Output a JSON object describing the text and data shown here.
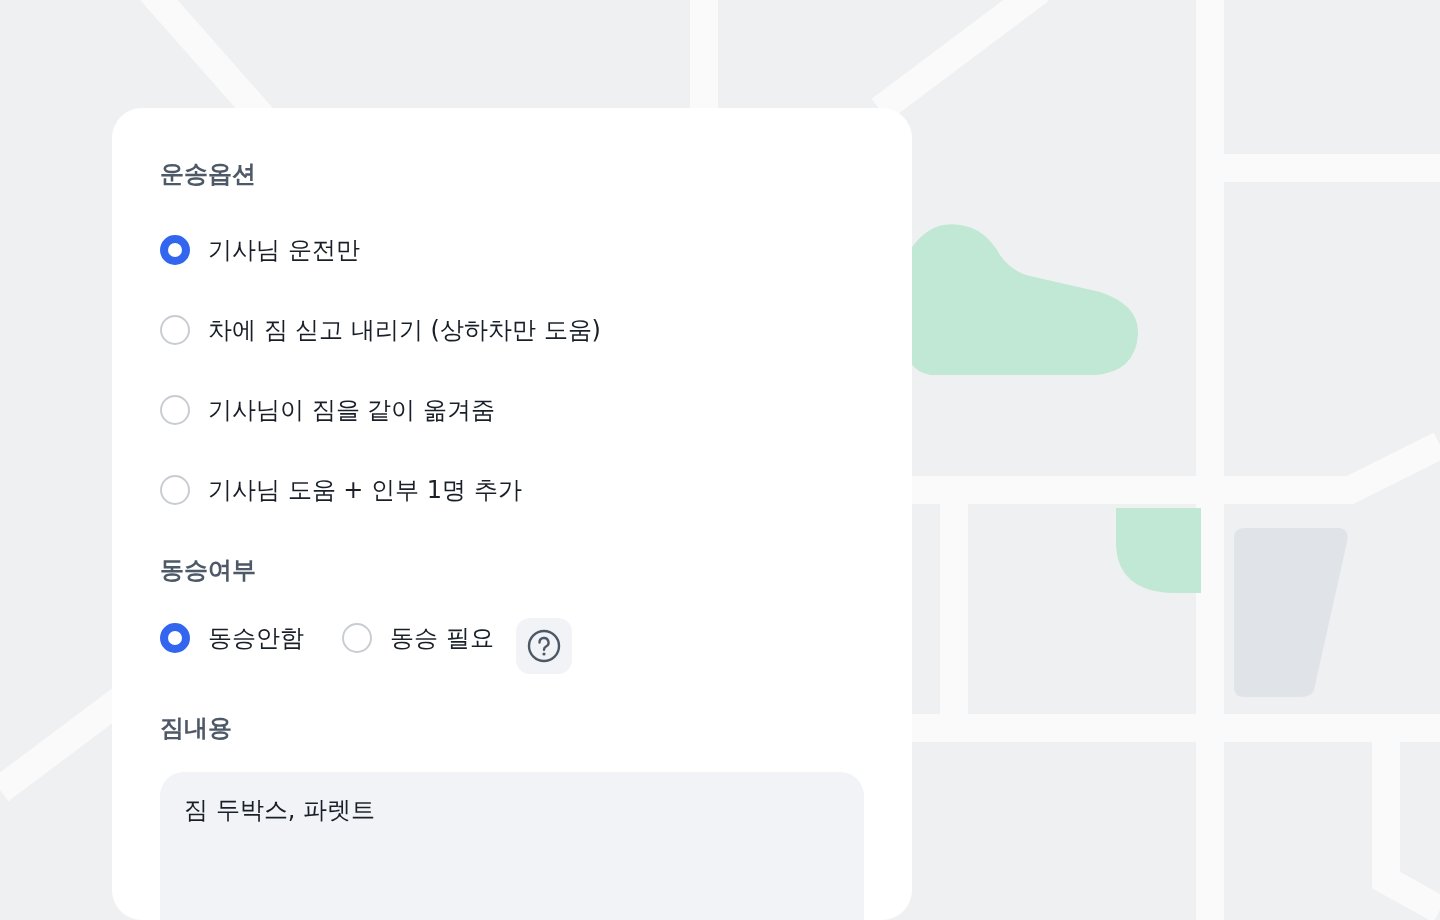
{
  "sections": [
    {
      "kind": "radio",
      "title": "운송옵션",
      "options": [
        {
          "label": "기사님 운전만",
          "selected": true
        },
        {
          "label": "차에 짐 싣고 내리기 (상하차만 도움)",
          "selected": false
        },
        {
          "label": "기사님이 짐을 같이 옮겨줌",
          "selected": false
        },
        {
          "label": "기사님 도움 + 인부 1명 추가",
          "selected": false
        }
      ]
    },
    {
      "kind": "inline-radio",
      "title": "동승여부",
      "options": [
        {
          "label": "동승안함",
          "selected": true
        },
        {
          "label": "동승 필요",
          "selected": false
        }
      ],
      "help": true
    },
    {
      "kind": "text",
      "title": "짐내용",
      "value": "짐 두박스, 파렛트"
    }
  ]
}
